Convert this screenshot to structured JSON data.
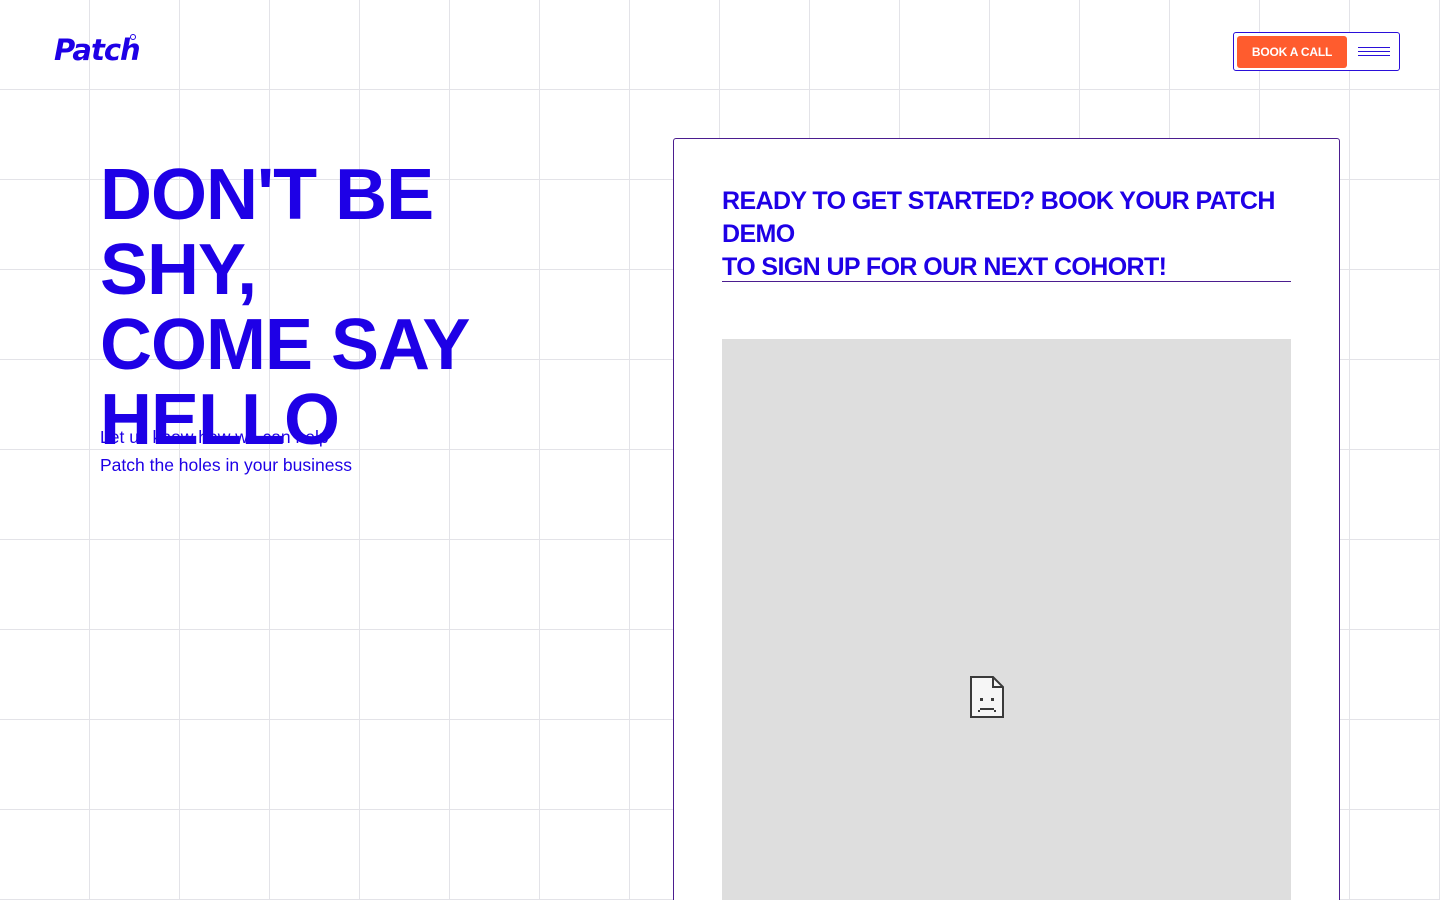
{
  "header": {
    "logo_text": "Patch",
    "book_call_label": "BOOK A CALL",
    "menu_icon": "hamburger-menu-icon"
  },
  "hero": {
    "title_lines": [
      "DON'T BE SHY,",
      "COME SAY",
      "HELLO"
    ],
    "subtitle_lines": [
      "Let us know how we can help",
      "Patch the holes in your business"
    ]
  },
  "card": {
    "title_lines": [
      "READY TO GET STARTED? BOOK YOUR PATCH DEMO",
      "TO SIGN UP FOR OUR NEXT COHORT!"
    ],
    "embed_icon": "broken-page-icon"
  },
  "colors": {
    "brand_blue": "#1e00e6",
    "accent_orange": "#ff5c2e",
    "border_purple": "#4b1d8f",
    "embed_gray": "#dedede",
    "grid_line": "#e3e3e8"
  }
}
